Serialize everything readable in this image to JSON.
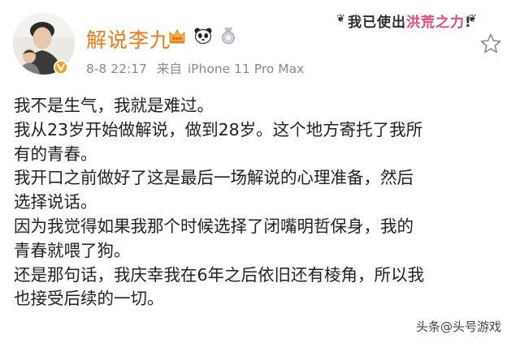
{
  "post": {
    "username": "解说李九",
    "timestamp": "8-8 22:17",
    "source_label": "来自",
    "device": "iPhone 11 Pro Max",
    "badges": [
      "crown-badge-icon",
      "panda-icon",
      "medal-icon"
    ],
    "sticker": {
      "left": "❦",
      "part1": "我已使出",
      "part2": "洪荒之力",
      "part3": "!",
      "right": "❦"
    },
    "body_lines": [
      "我不是生气，我就是难过。",
      "我从23岁开始做解说，做到28岁。这个地方寄托了我所",
      "有的青春。",
      "我开口之前做好了这是最后一场解说的心理准备，然后",
      "选择说话。",
      "因为我觉得如果我那个时候选择了闭嘴明哲保身，我的",
      "青春就喂了狗。",
      "还是那句话，我庆幸我在6年之后依旧还有棱角，所以我",
      "也接受后续的一切。"
    ]
  },
  "watermark": "头条@头号游戏",
  "colors": {
    "username": "#ea7a1c",
    "meta": "#8a8a8a",
    "body": "#222222",
    "verify_badge": "#f0a32a",
    "sticker_highlight": "#e4447a"
  }
}
